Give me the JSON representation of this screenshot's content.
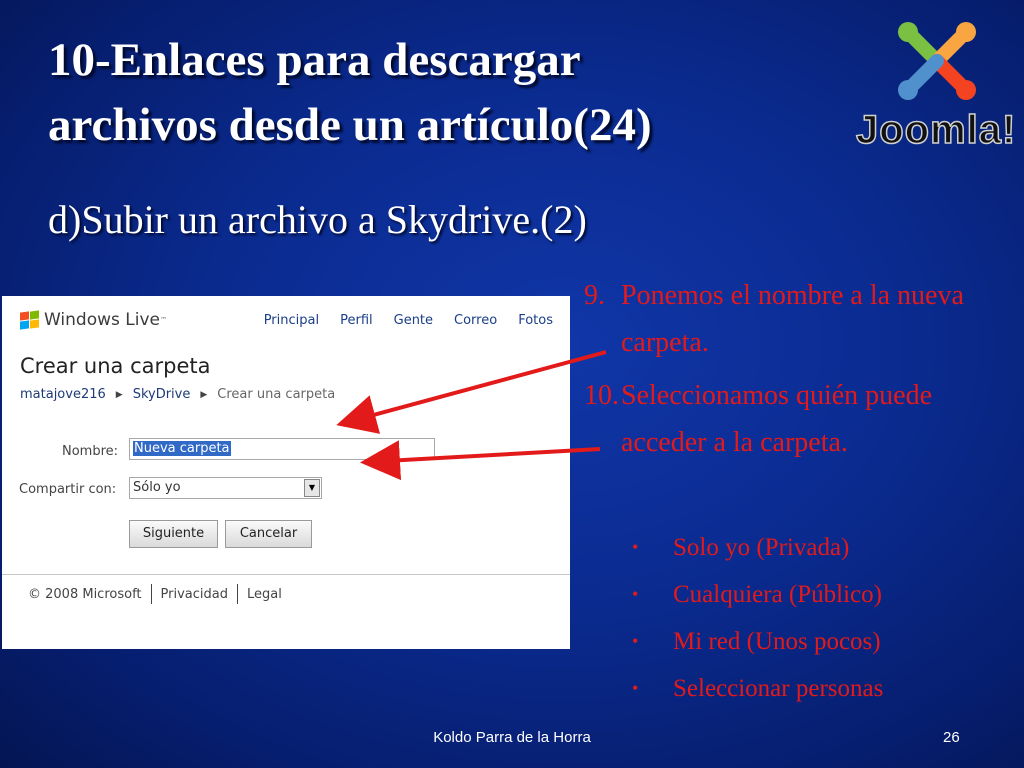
{
  "slide": {
    "title_line1": "10-Enlaces para descargar",
    "title_line2": "archivos desde un artículo(24)",
    "subtitle": "d)Subir un archivo a Skydrive.(2)",
    "logo_text": "Joomla!",
    "footer_author": "Koldo Parra de la Horra",
    "page_number": "26"
  },
  "screenshot": {
    "brand": "Windows Live",
    "brand_tm": "™",
    "nav": [
      "Principal",
      "Perfil",
      "Gente",
      "Correo",
      "Fotos"
    ],
    "page_title": "Crear una carpeta",
    "breadcrumb": {
      "user": "matajove216",
      "section": "SkyDrive",
      "current": "Crear una carpeta"
    },
    "name_label": "Nombre:",
    "name_value": "Nueva carpeta",
    "share_label": "Compartir con:",
    "share_value": "Sólo yo",
    "next_button": "Siguiente",
    "cancel_button": "Cancelar",
    "footer_copyright": "© 2008 Microsoft",
    "footer_privacy": "Privacidad",
    "footer_legal": "Legal"
  },
  "steps": {
    "step9_num": "9.",
    "step9_text": "Ponemos el nombre a la nueva carpeta.",
    "step10_num": "10.",
    "step10_text": "Seleccionamos quién puede acceder a la carpeta.",
    "options": [
      "Solo yo (Privada)",
      "Cualquiera (Público)",
      "Mi red (Unos pocos)",
      "Seleccionar personas"
    ]
  },
  "colors": {
    "text_red": "#e31a1a",
    "background": "#0a2a8e",
    "arrow": "#e31a1a"
  }
}
